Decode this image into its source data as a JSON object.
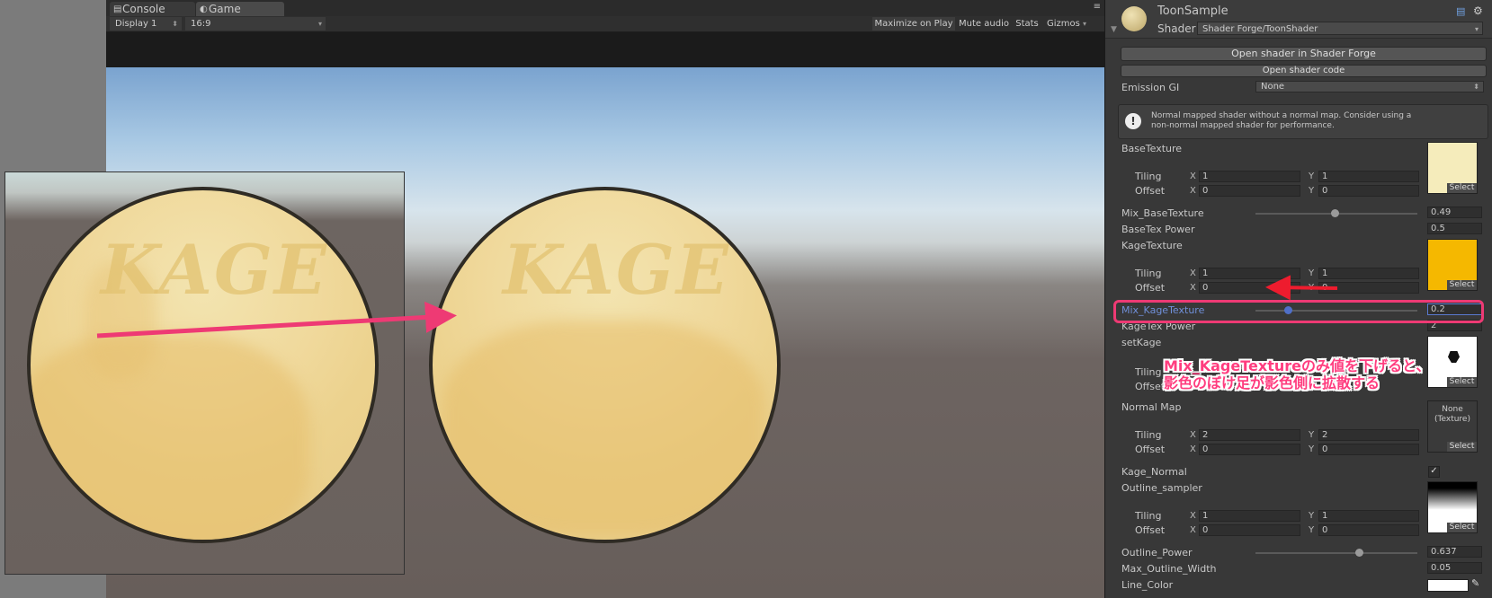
{
  "game_window": {
    "tabs": [
      {
        "label": "Console",
        "icon": "console-icon"
      },
      {
        "label": "Game",
        "icon": "game-icon"
      }
    ],
    "toolbar": {
      "display": "Display 1",
      "aspect": "16:9",
      "maximize": "Maximize on Play",
      "mute": "Mute audio",
      "stats": "Stats",
      "gizmos": "Gizmos"
    },
    "disc_text": "KAGE"
  },
  "inspector": {
    "material_name": "ToonSample",
    "shader_label": "Shader",
    "shader_value": "Shader Forge/ToonShader",
    "open_button": "Open shader in Shader Forge",
    "open_code_button": "Open shader code",
    "emission_label": "Emission GI",
    "emission_value": "None",
    "help_line1": "Normal mapped shader without a normal map. Consider using a",
    "help_line2": "non-normal mapped shader for performance.",
    "tiling_label": "Tiling",
    "offset_label": "Offset",
    "x_label": "X",
    "y_label": "Y",
    "select_label": "Select",
    "base_texture": {
      "label": "BaseTexture",
      "tiling_x": "1",
      "tiling_y": "1",
      "offset_x": "0",
      "offset_y": "0",
      "color": "#f5ecbb"
    },
    "mix_base": {
      "label": "Mix_BaseTexture",
      "value": "0.49",
      "fraction": 0.49
    },
    "base_power": {
      "label": "BaseTex Power",
      "value": "0.5"
    },
    "kage_texture": {
      "label": "KageTexture",
      "tiling_x": "1",
      "tiling_y": "1",
      "offset_x": "0",
      "offset_y": "0",
      "color": "#f5b800"
    },
    "mix_kage": {
      "label": "Mix_KageTexture",
      "value": "0.2",
      "fraction": 0.2
    },
    "kage_power": {
      "label": "KageTex Power",
      "value": "2"
    },
    "set_kage": {
      "label": "setKage"
    },
    "normal_map": {
      "label": "Normal Map",
      "tiling_x": "2",
      "tiling_y": "2",
      "offset_x": "0",
      "offset_y": "0",
      "thumb_text1": "None",
      "thumb_text2": "(Texture)"
    },
    "kage_normal": {
      "label": "Kage_Normal",
      "checked": true
    },
    "outline_sampler": {
      "label": "Outline_sampler",
      "tiling_x": "1",
      "tiling_y": "1",
      "offset_x": "0",
      "offset_y": "0"
    },
    "outline_power": {
      "label": "Outline_Power",
      "value": "0.637",
      "fraction": 0.637
    },
    "max_outline": {
      "label": "Max_Outline_Width",
      "value": "0.05"
    },
    "line_color": {
      "label": "Line_Color"
    }
  },
  "annotation": {
    "line1": "Mix_KageTextureのみ値を下げると、",
    "line2": "影色のぼけ足が影色側に拡散する"
  },
  "colors": {
    "accent_pink": "#ee3a74",
    "highlight_blue": "#6f8fd8"
  }
}
